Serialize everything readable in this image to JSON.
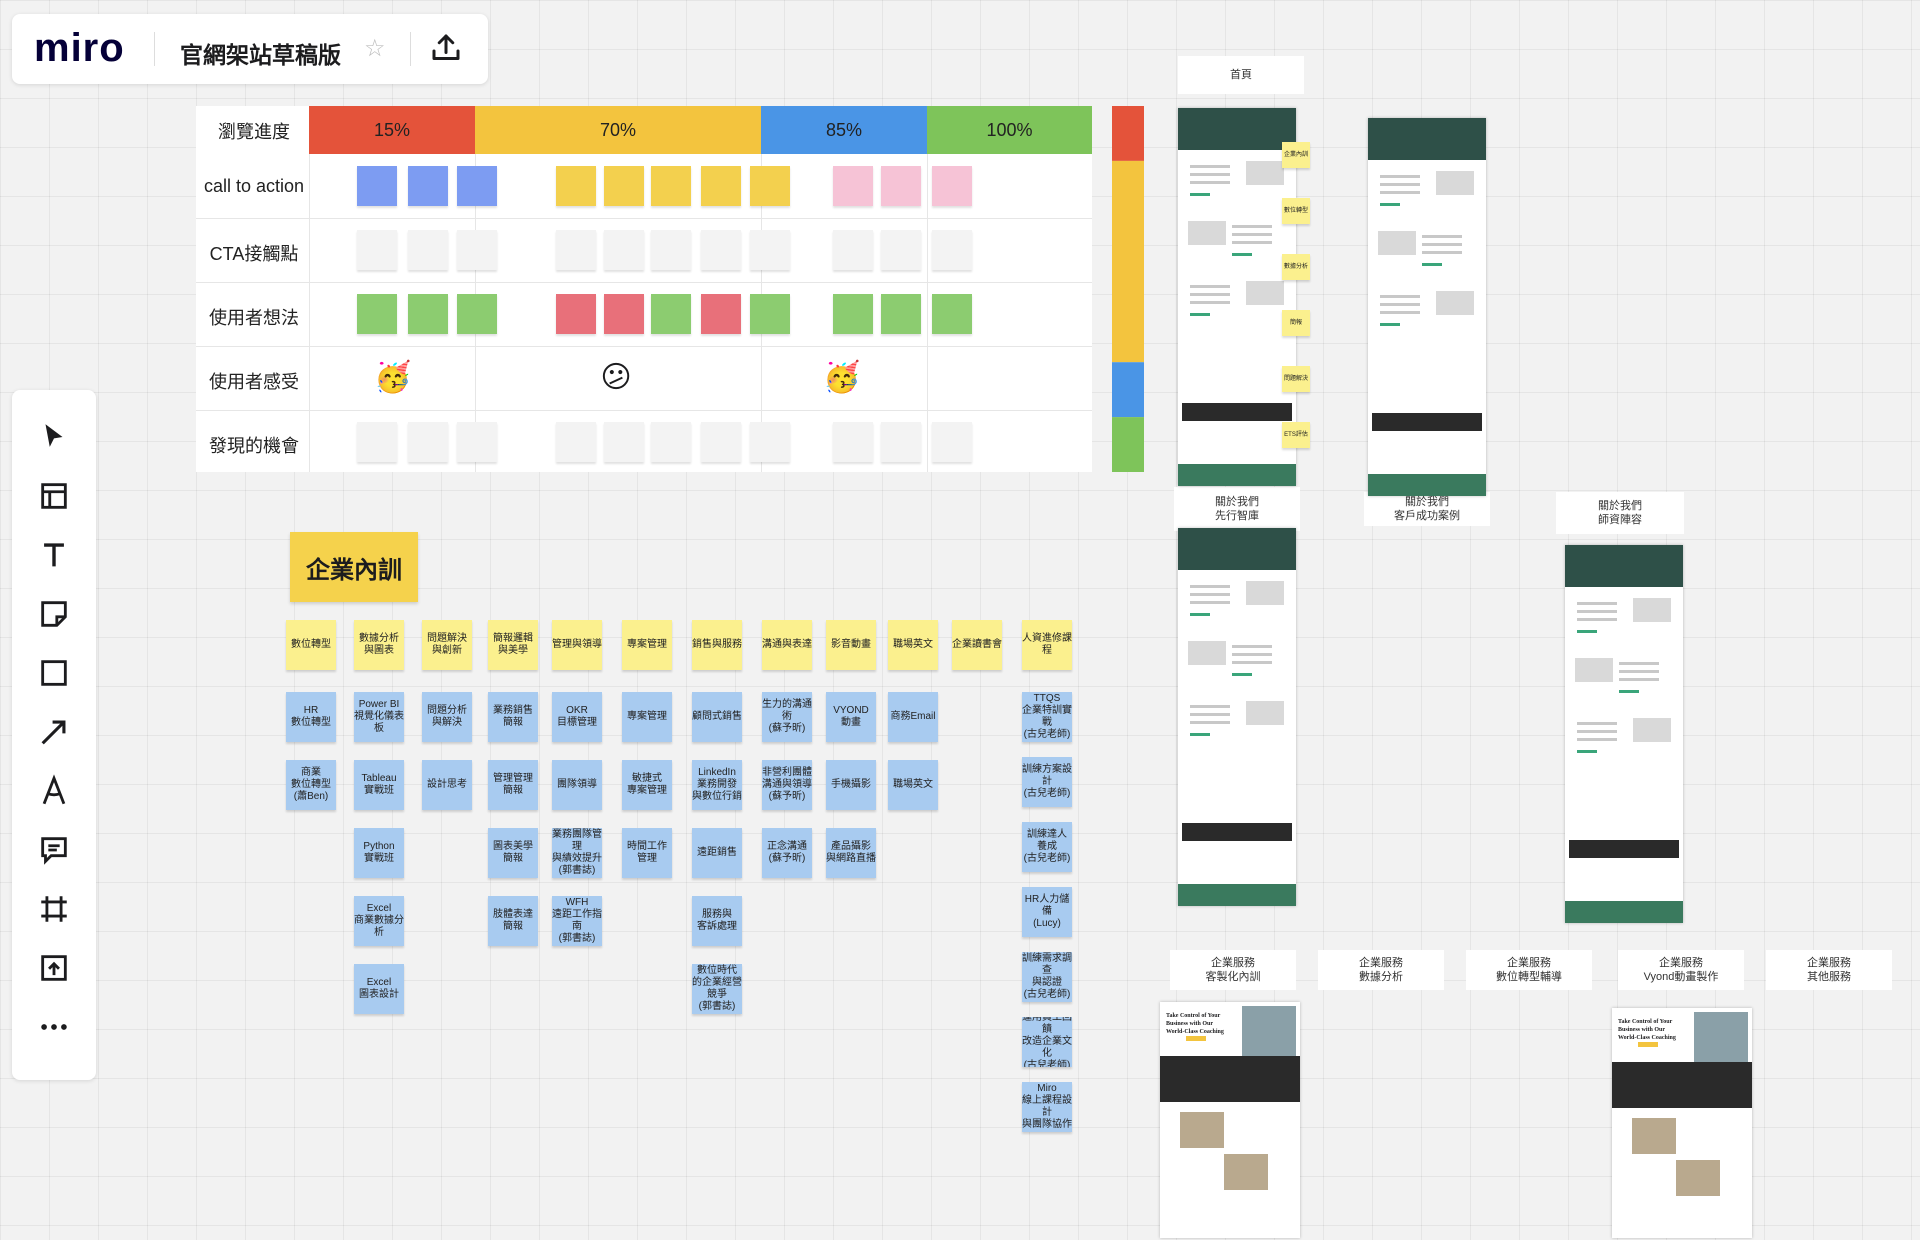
{
  "app": {
    "logo": "miro",
    "board_title": "官網架站草稿版",
    "icons": {
      "star": "star-icon",
      "share": "upload-icon"
    }
  },
  "toolbar": {
    "tools": [
      "select-cursor-icon",
      "templates-icon",
      "text-icon",
      "sticky-note-icon",
      "shape-icon",
      "arrow-icon",
      "pen-icon",
      "comment-icon",
      "frame-icon",
      "upload-icon",
      "more-icon"
    ]
  },
  "journey": {
    "header_label": "瀏覽進度",
    "stages": [
      {
        "label": "15%",
        "color": "#e4533a"
      },
      {
        "label": "70%",
        "color": "#f3c43e"
      },
      {
        "label": "85%",
        "color": "#4a95e6"
      },
      {
        "label": "100%",
        "color": "#7ec45a"
      }
    ],
    "rows": [
      "call to action",
      "CTA接觸點",
      "使用者想法",
      "使用者感受",
      "發現的機會"
    ],
    "cta_colors": [
      "#7d9cf2",
      "#f3d04e",
      "#f6c3d6"
    ],
    "thought_colors": {
      "s1": [
        "#8ccc70",
        "#8ccc70",
        "#8ccc70"
      ],
      "s2": [
        "#e8707a",
        "#e8707a",
        "#8ccc70",
        "#e8707a",
        "#8ccc70"
      ],
      "s3": [
        "#8ccc70",
        "#8ccc70",
        "#8ccc70"
      ]
    },
    "feelings": [
      "🥳",
      "😕",
      "🥳"
    ],
    "empty_note_color": "#f3f3f3",
    "progress_bar": [
      {
        "color": "#e4533a",
        "fraction": 0.15
      },
      {
        "color": "#f3c43e",
        "fraction": 0.55
      },
      {
        "color": "#4a95e6",
        "fraction": 0.15
      },
      {
        "color": "#7ec45a",
        "fraction": 0.15
      }
    ]
  },
  "training": {
    "title": "企業內訓",
    "categories": [
      "數位轉型",
      "數據分析\n與圖表",
      "問題解決\n與創新",
      "簡報邏輯\n與美學",
      "管理與領導",
      "專案管理",
      "銷售與服務",
      "溝通與表達",
      "影音動畫",
      "職場英文",
      "企業讀書會",
      "人資進修課程"
    ],
    "columns": [
      [
        "HR\n數位轉型",
        "商業\n數位轉型\n(蕭Ben)"
      ],
      [
        "Power BI\n視覺化儀表板",
        "Tableau\n實戰班",
        "Python\n實戰班",
        "Excel\n商業數據分析",
        "Excel\n圖表設計"
      ],
      [
        "問題分析\n與解決",
        "設計思考"
      ],
      [
        "業務銷售\n簡報",
        "管理管理\n簡報",
        "圖表美學\n簡報",
        "肢體表達\n簡報"
      ],
      [
        "OKR\n目標管理",
        "團隊領導",
        "業務團隊管理\n與績效提升\n(郭書誌)",
        "WFH\n遠距工作指南\n(郭書誌)"
      ],
      [
        "專案管理",
        "敏捷式\n專案管理",
        "時間工作\n管理"
      ],
      [
        "顧問式銷售",
        "LinkedIn\n業務開發\n與數位行銷",
        "遠距銷售",
        "服務與\n客訴處理",
        "數位時代\n的企業經營競爭\n(郭書誌)"
      ],
      [
        "生力的溝通術\n(蘇予昕)",
        "非營利團體\n溝通與領導\n(蘇予昕)",
        "正念溝通\n(蘇予昕)"
      ],
      [
        "VYOND\n動畫",
        "手機攝影",
        "產品攝影\n與網路直播"
      ],
      [
        "商務Email",
        "職場英文"
      ],
      [],
      [
        "TTQS\n企業特訓實戰\n(古兒老師)",
        "訓練方案設計\n(古兒老師)",
        "訓練達人\n養成\n(古兒老師)",
        "HR人力儲備\n(Lucy)",
        "訓練需求調查\n與認證\n(古兒老師)",
        "運用員工回饋\n改造企業文化\n(古兒老師)",
        "Miro\n線上課程設計\n與團隊協作"
      ]
    ]
  },
  "frames": {
    "home_label": "首頁",
    "home_side_notes": [
      "企業內訓",
      "數位轉型",
      "數據分析",
      "簡報",
      "問題解決",
      "ETS評估"
    ],
    "about1_label": "關於我們\n先行智庫",
    "about2_label": "關於我們\n客戶成功案例",
    "about3_label": "關於我們\n師資陣容",
    "services": [
      "企業服務\n客製化內訓",
      "企業服務\n數據分析",
      "企業服務\n數位轉型輔導",
      "企業服務\nVyond動畫製作",
      "企業服務\n其他服務"
    ],
    "cover_headline": "Take Control of Your\nBusiness with Our\nWorld-Class Coaching"
  }
}
